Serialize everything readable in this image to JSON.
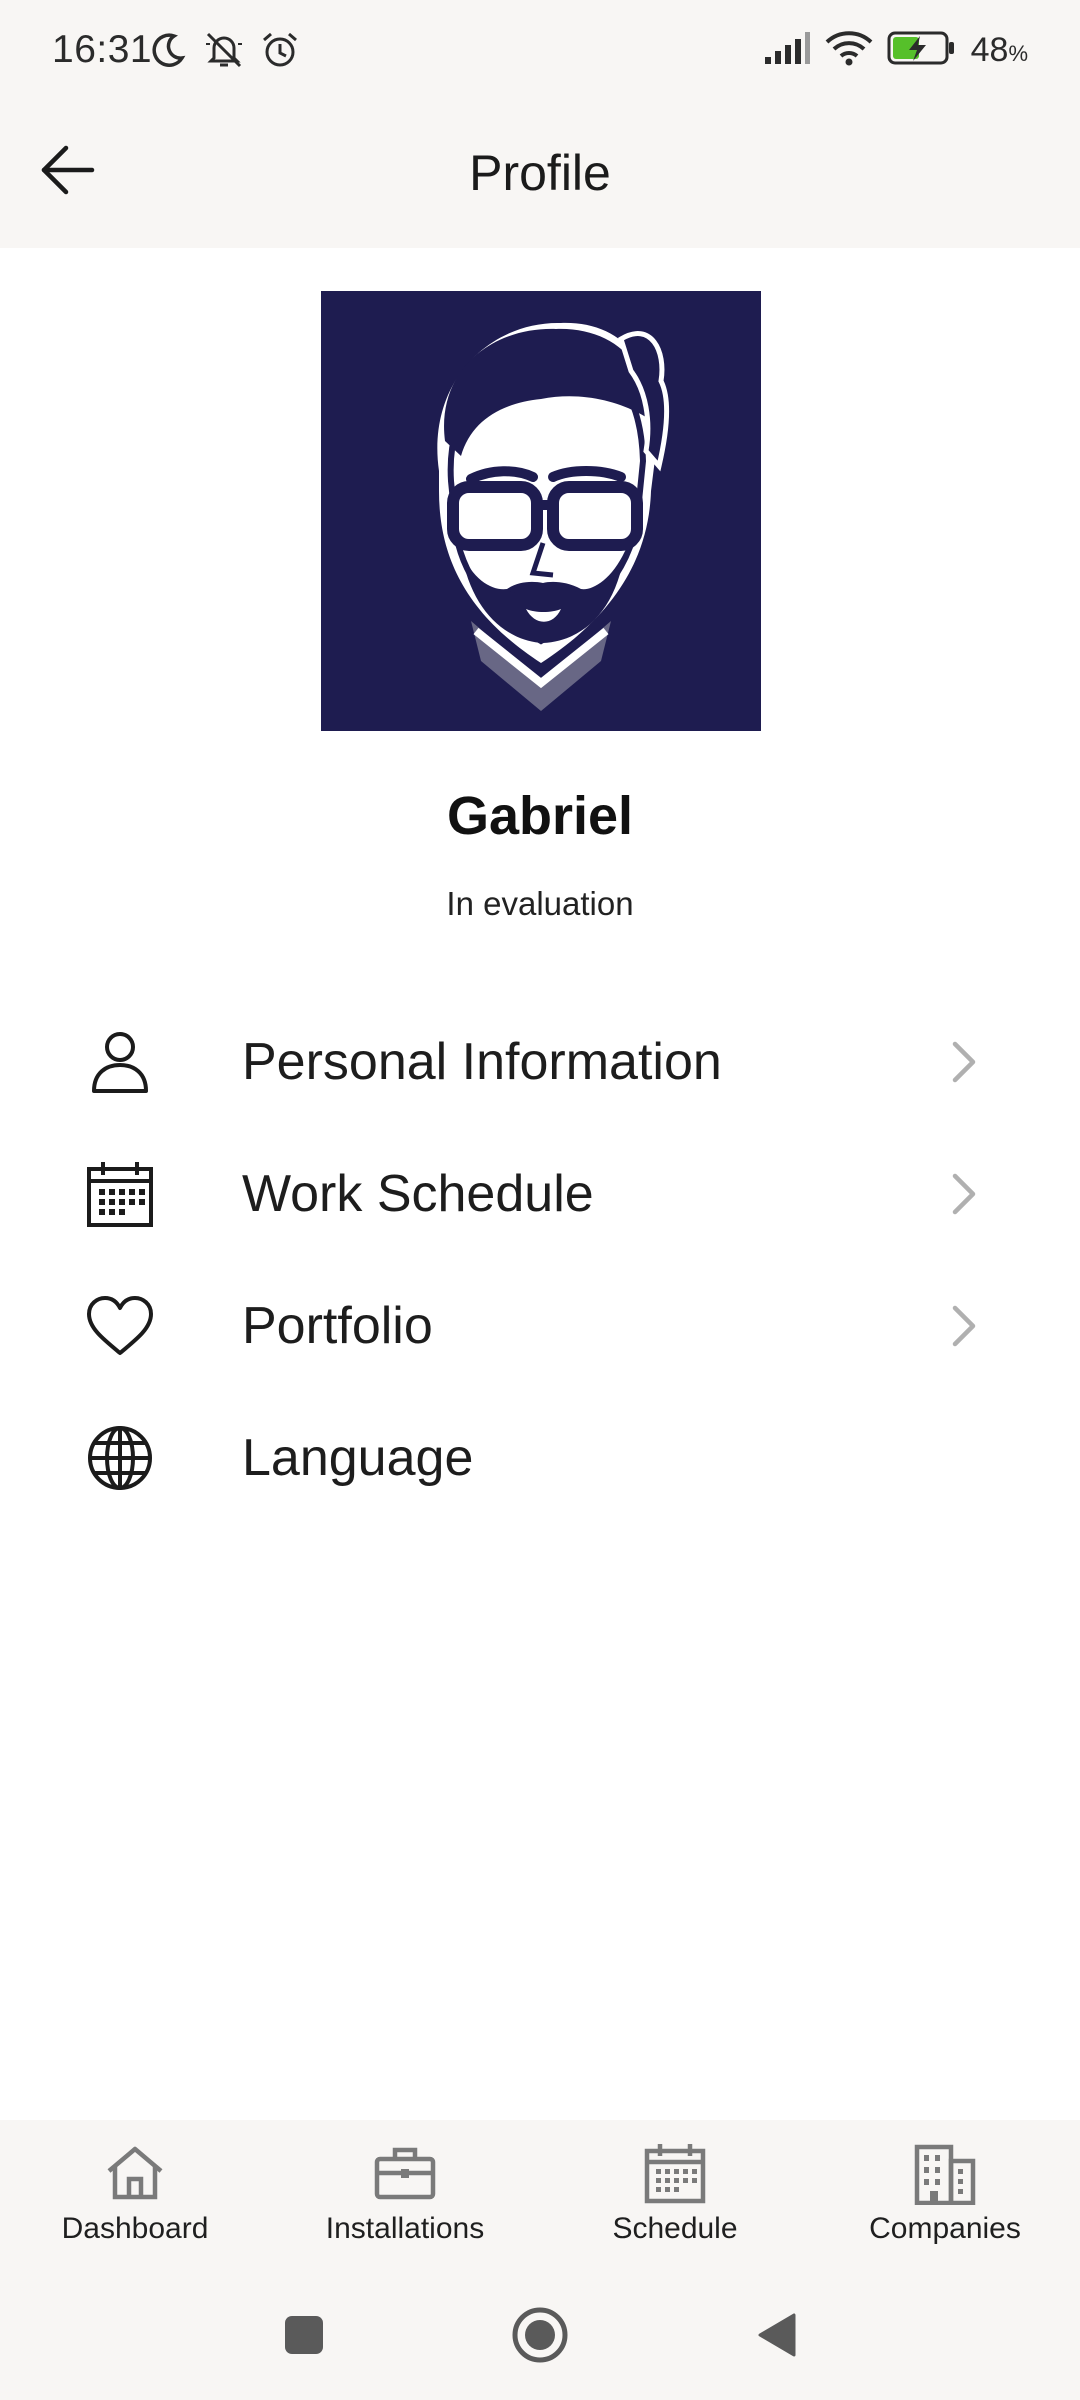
{
  "status_bar": {
    "time": "16:31",
    "battery_percent": "48",
    "battery_unit": "%",
    "icons": [
      "moon-icon",
      "bell-muted-icon",
      "alarm-icon",
      "signal-icon",
      "wifi-icon",
      "battery-charging-icon"
    ]
  },
  "app_bar": {
    "title": "Profile",
    "back_icon": "arrow-left-icon"
  },
  "profile": {
    "name": "Gabriel",
    "status": "In evaluation",
    "avatar_bg": "#1e1c50"
  },
  "menu": {
    "items": [
      {
        "label": "Personal Information",
        "icon": "person-icon",
        "has_chevron": true
      },
      {
        "label": "Work Schedule",
        "icon": "calendar-icon",
        "has_chevron": true
      },
      {
        "label": "Portfolio",
        "icon": "heart-icon",
        "has_chevron": true
      },
      {
        "label": "Language",
        "icon": "globe-icon",
        "has_chevron": false
      }
    ]
  },
  "bottom_nav": {
    "items": [
      {
        "label": "Dashboard",
        "icon": "home-icon"
      },
      {
        "label": "Installations",
        "icon": "briefcase-icon"
      },
      {
        "label": "Schedule",
        "icon": "calendar-icon"
      },
      {
        "label": "Companies",
        "icon": "building-icon"
      }
    ]
  },
  "system_nav": {
    "buttons": [
      "recents-button",
      "home-button",
      "back-button"
    ]
  },
  "colors": {
    "bar_background": "#f8f6f4",
    "page_background": "#ffffff",
    "text": "#1b1b1b",
    "icon_gray": "#7a7a7a",
    "chevron_gray": "#b0b0b0",
    "avatar_navy": "#1e1c50"
  }
}
